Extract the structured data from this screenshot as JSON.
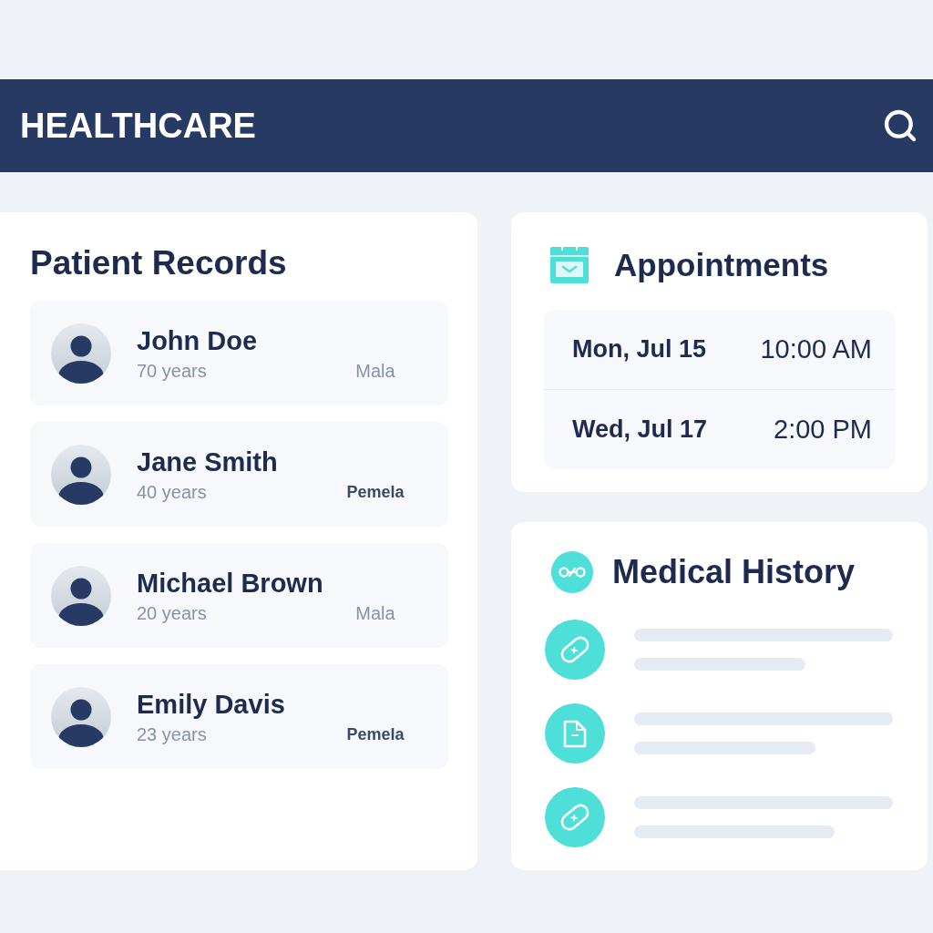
{
  "header": {
    "title": "HEALTHCARE"
  },
  "patient_records": {
    "title": "Patient Records",
    "patients": [
      {
        "name": "John Doe",
        "age": "70 years",
        "gender": "Mala",
        "highlighted": false
      },
      {
        "name": "Jane Smith",
        "age": "40 years",
        "gender": "Pemela",
        "highlighted": true
      },
      {
        "name": "Michael Brown",
        "age": "20 years",
        "gender": "Mala",
        "highlighted": false
      },
      {
        "name": "Emily Davis",
        "age": "23 years",
        "gender": "Pemela",
        "highlighted": true
      }
    ]
  },
  "appointments": {
    "title": "Appointments",
    "rows": [
      {
        "date": "Mon, Jul 15",
        "time": "10:00 AM"
      },
      {
        "date": "Wed, Jul 17",
        "time": "2:00 PM"
      }
    ]
  },
  "medical_history": {
    "title": "Medical History",
    "items": [
      {
        "kind": "bandage"
      },
      {
        "kind": "document"
      },
      {
        "kind": "bandage"
      }
    ]
  }
}
